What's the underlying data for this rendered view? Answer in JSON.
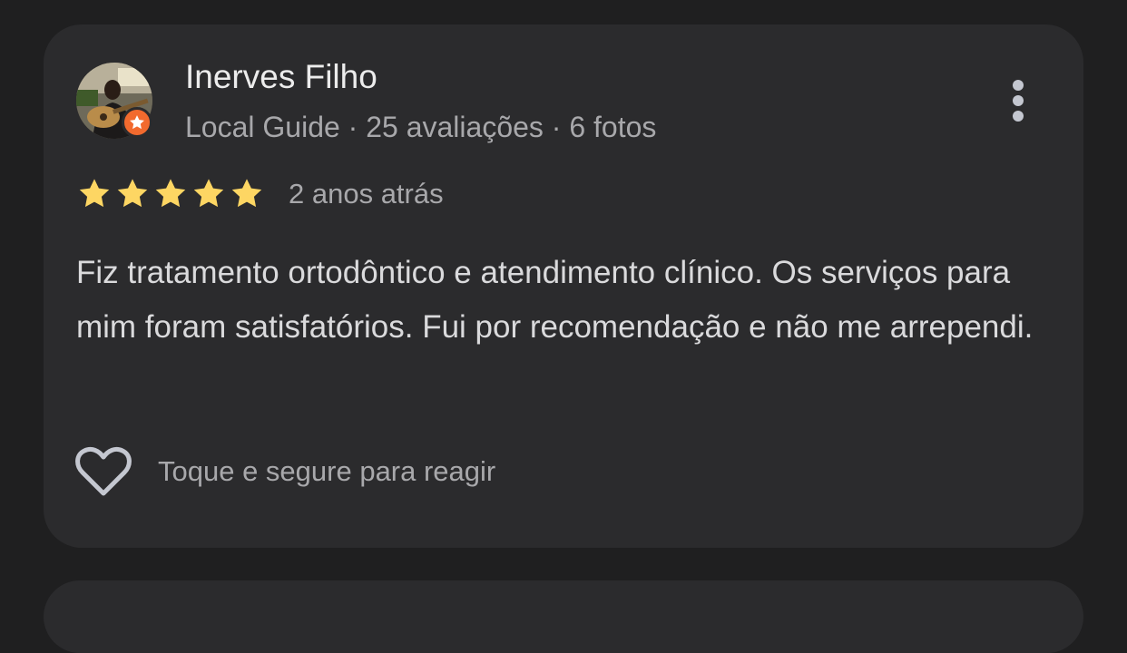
{
  "review": {
    "author_name": "Inerves Filho",
    "author_level": "Local Guide",
    "separator": "·",
    "reviews_count": "25 avaliações",
    "photos_count": "6 fotos",
    "rating": 5,
    "rating_max": 5,
    "time_ago": "2 anos atrás",
    "text": "Fiz tratamento ortodôntico e atendimento clínico. Os serviços para mim foram satisfatórios. Fui por recomendação e não me arrependi.",
    "react_hint": "Toque e segure para reagir"
  },
  "icons": {
    "avatar": "profile-photo",
    "badge": "local-guide-star-icon",
    "more": "more-vertical-icon",
    "star": "star-icon",
    "heart": "heart-outline-icon"
  },
  "colors": {
    "background": "#1f1f20",
    "card": "#2b2b2d",
    "star": "#fdd663",
    "badge": "#f26a2e",
    "primary_text": "#ececec",
    "secondary_text": "#a8a8ab",
    "icon": "#c4c7d0"
  }
}
